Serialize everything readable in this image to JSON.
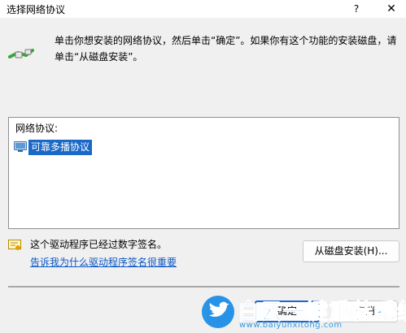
{
  "window": {
    "title": "选择网络协议",
    "help_glyph": "?",
    "close_glyph": "✕"
  },
  "instruction": "单击你想安装的网络协议，然后单击“确定”。如果你有这个功能的安装磁盘，请单击“从磁盘安装”。",
  "protocol_list": {
    "caption": "网络协议:",
    "items": [
      {
        "label": "可靠多播协议",
        "selected": true,
        "icon": "protocol-icon"
      }
    ]
  },
  "driver": {
    "signed_text": "这个驱动程序已经过数字签名。",
    "link_text": "告诉我为什么驱动程序签名很重要",
    "icon": "certificate-icon"
  },
  "buttons": {
    "have_disk": "从磁盘安装(H)...",
    "ok": "确定",
    "cancel": "取消"
  },
  "watermark": {
    "title": "白云一键重装系统",
    "url": "www.baiyunxitong.com",
    "icon": "bird-logo-icon"
  },
  "colors": {
    "accent": "#1a68c8",
    "link": "#0a56c5",
    "watermark": "#1e8fe6"
  }
}
